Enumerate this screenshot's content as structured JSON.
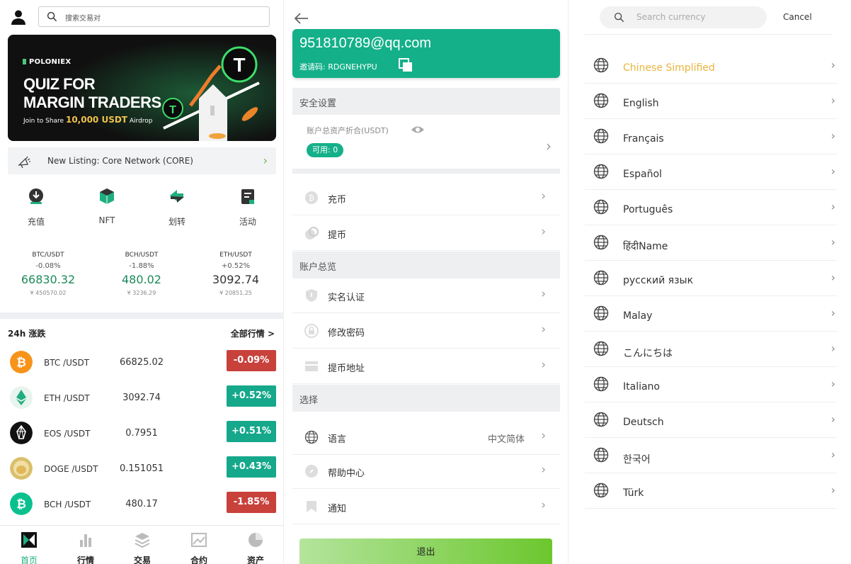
{
  "home": {
    "search_placeholder": "搜索交易对",
    "banner": {
      "brand": "POLONIEX",
      "title_line1": "QUIZ FOR",
      "title_line2": "MARGIN TRADERS",
      "sub_prefix": "Join to Share",
      "sub_amount": "10,000 USDT",
      "sub_suffix": "Airdrop"
    },
    "notice": "New Listing: Core Network (CORE)",
    "quick_actions": [
      {
        "label": "充值",
        "icon": "deposit-icon"
      },
      {
        "label": "NFT",
        "icon": "nft-icon"
      },
      {
        "label": "划转",
        "icon": "transfer-icon"
      },
      {
        "label": "活动",
        "icon": "activity-icon"
      }
    ],
    "tickers": [
      {
        "pair": "BTC/USDT",
        "change": "-0.08%",
        "price": "66830.32",
        "cny": "¥ 450570.02"
      },
      {
        "pair": "BCH/USDT",
        "change": "-1.88%",
        "price": "480.02",
        "cny": "¥ 3236.29"
      },
      {
        "pair": "ETH/USDT",
        "change": "+0.52%",
        "price": "3092.74",
        "cny": "¥ 20851.25"
      }
    ],
    "market_title": "24h 涨跌",
    "market_all": "全部行情 >",
    "market": [
      {
        "symbol": "BTC /USDT",
        "price": "66825.02",
        "change": "-0.09%",
        "dir": "down",
        "coin_color": "#f7931a"
      },
      {
        "symbol": "ETH /USDT",
        "price": "3092.74",
        "change": "+0.52%",
        "dir": "up",
        "coin_color": "#e8f4ee"
      },
      {
        "symbol": "EOS /USDT",
        "price": "0.7951",
        "change": "+0.51%",
        "dir": "up",
        "coin_color": "#111111"
      },
      {
        "symbol": "DOGE /USDT",
        "price": "0.151051",
        "change": "+0.43%",
        "dir": "up",
        "coin_color": "#d9bf6b"
      },
      {
        "symbol": "BCH /USDT",
        "price": "480.17",
        "change": "-1.85%",
        "dir": "down",
        "coin_color": "#0ac18e"
      }
    ],
    "tabs": [
      {
        "label": "首页",
        "icon": "home-icon"
      },
      {
        "label": "行情",
        "icon": "market-icon"
      },
      {
        "label": "交易",
        "icon": "trade-icon"
      },
      {
        "label": "合约",
        "icon": "contract-icon"
      },
      {
        "label": "资产",
        "icon": "assets-icon"
      }
    ]
  },
  "account": {
    "email": "951810789@qq.com",
    "invite_label": "邀请码: RDGNEHYPU",
    "security_title": "安全设置",
    "assets_label": "账户总资产折合(USDT)",
    "available": "可用: 0",
    "menu1": [
      {
        "label": "充币",
        "icon": "deposit-coin-icon"
      },
      {
        "label": "提币",
        "icon": "withdraw-coin-icon"
      }
    ],
    "overview_title": "账户总览",
    "menu2": [
      {
        "label": "实名认证",
        "icon": "shield-icon"
      },
      {
        "label": "修改密码",
        "icon": "lock-icon"
      },
      {
        "label": "提币地址",
        "icon": "card-icon"
      }
    ],
    "select_title": "选择",
    "menu3": [
      {
        "label": "语言",
        "value": "中文简体",
        "icon": "globe-icon"
      },
      {
        "label": "帮助中心",
        "value": "",
        "icon": "compass-icon"
      },
      {
        "label": "通知",
        "value": "",
        "icon": "bookmark-icon"
      }
    ],
    "logout": "退出"
  },
  "language": {
    "search_placeholder": "Search currency",
    "cancel": "Cancel",
    "items": [
      {
        "label": "Chinese Simplified",
        "selected": true
      },
      {
        "label": "English"
      },
      {
        "label": "Français"
      },
      {
        "label": "Español"
      },
      {
        "label": "Português"
      },
      {
        "label": "हिंदीName"
      },
      {
        "label": "русский язык"
      },
      {
        "label": "Malay"
      },
      {
        "label": "こんにちは"
      },
      {
        "label": "Italiano"
      },
      {
        "label": "Deutsch"
      },
      {
        "label": "한국어"
      },
      {
        "label": "Türk"
      }
    ]
  },
  "colors": {
    "accent": "#14b08a",
    "up": "#15a88b",
    "down": "#c8413b",
    "selected_lang": "#e9b53b"
  }
}
